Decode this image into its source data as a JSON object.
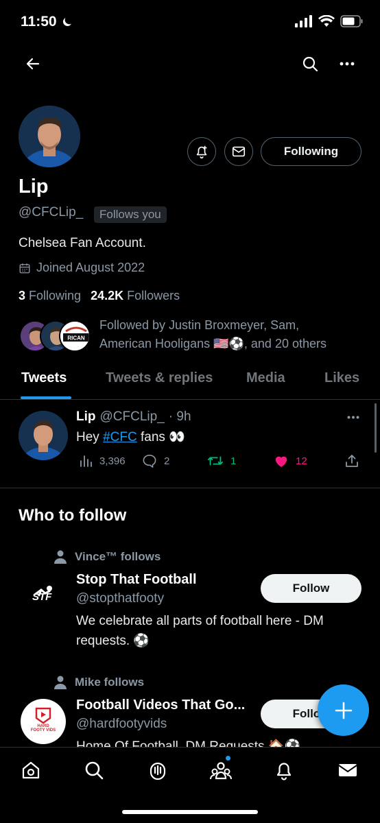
{
  "status_bar": {
    "time": "11:50",
    "icons": [
      "moon-icon",
      "signal-icon",
      "wifi-icon",
      "battery-icon"
    ]
  },
  "top_nav": {
    "icons": [
      "back-arrow-icon",
      "search-icon",
      "more-icon"
    ]
  },
  "profile": {
    "name": "Lip",
    "handle": "@CFCLip_",
    "follows_you": "Follows you",
    "bio": "Chelsea Fan Account.",
    "joined": "Joined August 2022",
    "following_count": "3",
    "following_label": "Following",
    "followers_count": "24.2K",
    "followers_label": "Followers",
    "followed_by_line1": "Followed by Justin Broxmeyer, Sam,",
    "followed_by_line2": "American Hooligans 🇺🇸⚽, and 20 others",
    "following_button": "Following"
  },
  "tabs": [
    {
      "label": "Tweets",
      "active": true
    },
    {
      "label": "Tweets & replies",
      "active": false
    },
    {
      "label": "Media",
      "active": false
    },
    {
      "label": "Likes",
      "active": false
    }
  ],
  "tweet": {
    "name": "Lip",
    "handle": "@CFCLip_",
    "time": "· 9h",
    "text_before": "Hey ",
    "hashtag": "#CFC",
    "text_after": " fans 👀",
    "views": "3,396",
    "replies": "2",
    "retweets": "1",
    "likes": "12"
  },
  "who_to_follow": {
    "title": "Who to follow",
    "suggestions": [
      {
        "social_context": "Vince™ follows",
        "name": "Stop That Football",
        "handle": "@stopthatfooty",
        "bio_line1": "We celebrate all parts of football here - DM",
        "bio_line2": "requests. ⚽",
        "button": "Follow",
        "logo_text": "STF"
      },
      {
        "social_context": "Mike follows",
        "name": "Football Videos That Go...",
        "handle": "@hardfootyvids",
        "bio_line1": "Home Of Football. DM Requests 🏠⚽",
        "button": "Follow",
        "logo_text": "HARD FOOTY VIDS"
      }
    ]
  },
  "bottom_nav": {
    "icons": [
      "home-icon",
      "search-icon",
      "spaces-icon",
      "communities-icon",
      "notifications-icon",
      "messages-icon"
    ]
  },
  "colors": {
    "accent": "#1d9bf0",
    "retweet": "#00ba7c",
    "like": "#f91880",
    "background": "#000000"
  }
}
